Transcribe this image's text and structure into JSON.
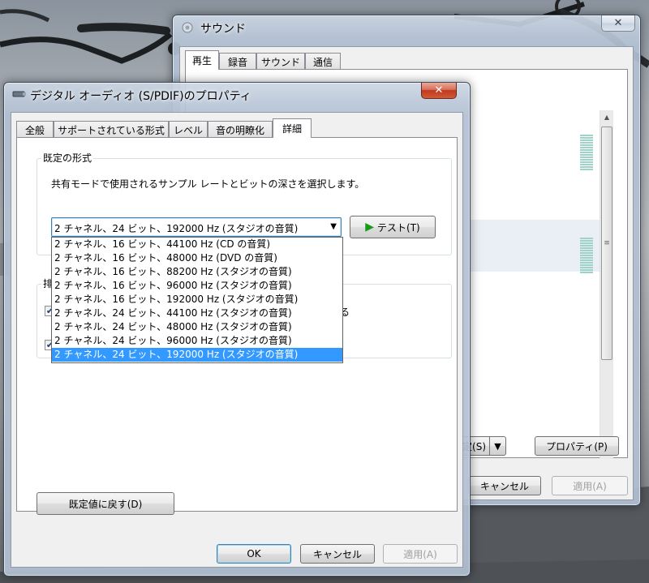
{
  "background_window": {
    "title": "サウンド",
    "tabs": [
      "再生",
      "録音",
      "サウンド",
      "通信"
    ],
    "set_default_label": "定(S)",
    "properties_label": "プロパティ(P)",
    "cancel_label": "キャンセル",
    "apply_label": "適用(A)"
  },
  "dialog": {
    "title": "デジタル オーディオ (S/PDIF)のプロパティ",
    "tabs": [
      "全般",
      "サポートされている形式",
      "レベル",
      "音の明瞭化",
      "詳細"
    ],
    "active_tab": "詳細",
    "default_format": {
      "group_label": "既定の形式",
      "description": "共有モードで使用されるサンプル レートとビットの深さを選択します。",
      "selected_value": "2 チャネル、24 ビット、192000 Hz (スタジオの音質)",
      "test_button": "テスト(T)",
      "options": [
        "2 チャネル、16 ビット、44100 Hz (CD の音質)",
        "2 チャネル、16 ビット、48000 Hz (DVD の音質)",
        "2 チャネル、16 ビット、88200 Hz (スタジオの音質)",
        "2 チャネル、16 ビット、96000 Hz (スタジオの音質)",
        "2 チャネル、16 ビット、192000 Hz (スタジオの音質)",
        "2 チャネル、24 ビット、44100 Hz (スタジオの音質)",
        "2 チャネル、24 ビット、48000 Hz (スタジオの音質)",
        "2 チャネル、24 ビット、96000 Hz (スタジオの音質)",
        "2 チャネル、24 ビット、192000 Hz (スタジオの音質)"
      ],
      "highlighted_option_index": 8
    },
    "exclusive_mode": {
      "group_label_partial": "排",
      "checkbox1_checked": true,
      "checkbox1_text_partial": "る",
      "checkbox2_checked": true
    },
    "restore_defaults_label": "既定値に戻す(D)",
    "ok_label": "OK",
    "cancel_label": "キャンセル",
    "apply_label": "適用(A)"
  },
  "icons": {
    "close": "close-icon",
    "speaker": "speaker-icon",
    "play": "play-icon",
    "dropdown_arrow": "chevron-down-icon"
  },
  "colors": {
    "selection": "#3399ff",
    "play_icon": "#1a9a1a",
    "close_red": "#c1391c"
  }
}
